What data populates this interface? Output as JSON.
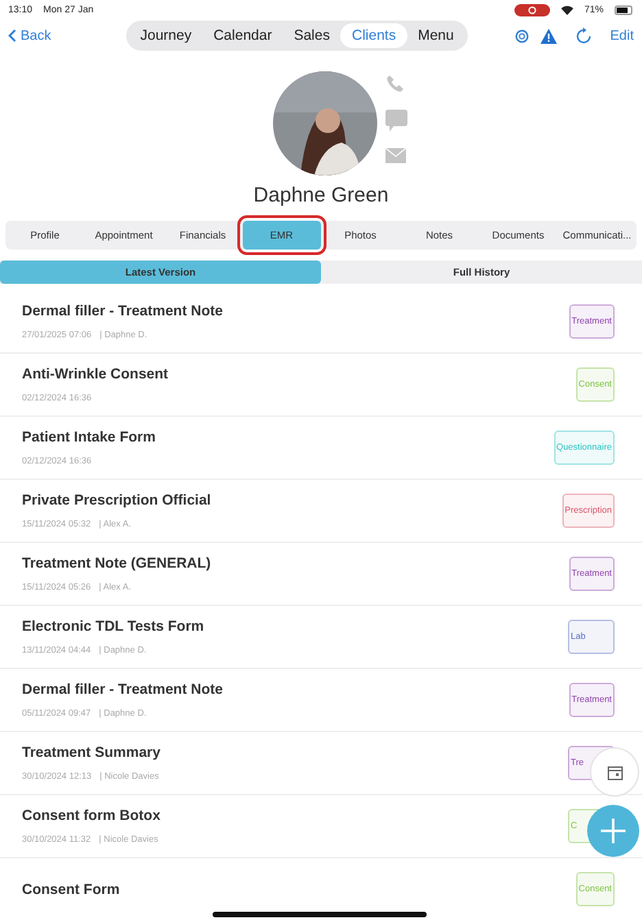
{
  "status_bar": {
    "time": "13:10",
    "date": "Mon 27 Jan",
    "battery": "71%"
  },
  "nav": {
    "back": "Back",
    "segments": [
      {
        "label": "Journey",
        "selected": false
      },
      {
        "label": "Calendar",
        "selected": false
      },
      {
        "label": "Sales",
        "selected": false
      },
      {
        "label": "Clients",
        "selected": true
      },
      {
        "label": "Menu",
        "selected": false
      }
    ],
    "edit": "Edit"
  },
  "client": {
    "name": "Daphne Green"
  },
  "tabs": [
    {
      "label": "Profile",
      "selected": false,
      "outlined": false
    },
    {
      "label": "Appointment",
      "selected": false,
      "outlined": false
    },
    {
      "label": "Financials",
      "selected": false,
      "outlined": false
    },
    {
      "label": "EMR",
      "selected": true,
      "outlined": true
    },
    {
      "label": "Photos",
      "selected": false,
      "outlined": false
    },
    {
      "label": "Notes",
      "selected": false,
      "outlined": false
    },
    {
      "label": "Documents",
      "selected": false,
      "outlined": false
    },
    {
      "label": "Communicati...",
      "selected": false,
      "outlined": false
    }
  ],
  "subtabs": [
    {
      "label": "Latest Version",
      "selected": true
    },
    {
      "label": "Full History",
      "selected": false
    }
  ],
  "records": [
    {
      "title": "Dermal filler - Treatment Note",
      "date": "27/01/2025 07:06",
      "author": "| Daphne  D.",
      "tag": "Treatment",
      "color": "#8e44ad"
    },
    {
      "title": "Anti-Wrinkle Consent",
      "date": "02/12/2024 16:36",
      "tag": "Consent",
      "color": "#7cc242"
    },
    {
      "title": "Patient Intake Form",
      "date": "02/12/2024 16:36",
      "tag": "Questionnaire",
      "color": "#2ec4c4"
    },
    {
      "title": "Private Prescription Official",
      "date": "15/11/2024 05:32",
      "author": "| Alex A.",
      "tag": "Prescription",
      "color": "#d9546a"
    },
    {
      "title": "Treatment Note (GENERAL)",
      "date": "15/11/2024 05:26",
      "author": "| Alex A.",
      "tag": "Treatment",
      "color": "#8e44ad"
    },
    {
      "title": "Electronic TDL Tests Form",
      "date": "13/11/2024 04:44",
      "author": "| Daphne  D.",
      "tag": "Lab",
      "color": "#5b6fc4"
    },
    {
      "title": "Dermal filler - Treatment Note",
      "date": "05/11/2024 09:47",
      "author": "| Daphne  D.",
      "tag": "Treatment",
      "color": "#8e44ad"
    },
    {
      "title": "Treatment Summary",
      "date": "30/10/2024 12:13",
      "author": "| Nicole Davies",
      "tag": "Tre",
      "color": "#8e44ad"
    },
    {
      "title": "Consent form Botox",
      "date": "30/10/2024 11:32",
      "author": "| Nicole Davies",
      "tag": "C",
      "color": "#7cc242"
    },
    {
      "title": "Consent Form",
      "tag": "Consent",
      "color": "#7cc242"
    }
  ]
}
